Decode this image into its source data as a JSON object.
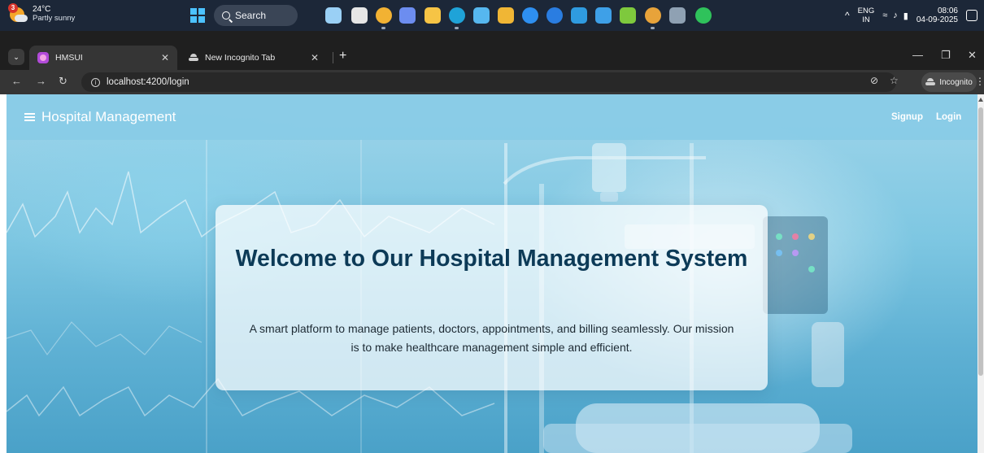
{
  "taskbar": {
    "weather": {
      "temp": "24°C",
      "condition": "Partly sunny",
      "badge": "3",
      "icon": "partly-sunny-icon"
    },
    "search_label": "Search",
    "apps": [
      {
        "name": "paint-app-icon",
        "color": "#9ad0f5"
      },
      {
        "name": "task-view-icon",
        "color": "#e6e6e6"
      },
      {
        "name": "chrome-icon",
        "color": "#f2b233"
      },
      {
        "name": "copilot-icon",
        "color": "#6c8df0"
      },
      {
        "name": "file-explorer-icon",
        "color": "#f6c445"
      },
      {
        "name": "edge-icon",
        "color": "#1fa3d8"
      },
      {
        "name": "terminal-app-icon",
        "color": "#56b7ef"
      },
      {
        "name": "store-icon",
        "color": "#f0b635"
      },
      {
        "name": "help-icon",
        "color": "#2e8ff0"
      },
      {
        "name": "hp-icon",
        "color": "#2a7de1"
      },
      {
        "name": "vscode-icon",
        "color": "#2f9be0"
      },
      {
        "name": "notepad-icon",
        "color": "#3ea0e8"
      },
      {
        "name": "spring-tool-icon",
        "color": "#7ec93d"
      },
      {
        "name": "chrome-v-icon",
        "color": "#e8a33a"
      },
      {
        "name": "cmd-icon",
        "color": "#8fa1b3"
      },
      {
        "name": "whatsapp-icon",
        "color": "#2fc25b"
      }
    ],
    "tray": {
      "lang_top": "ENG",
      "lang_bottom": "IN",
      "time": "08:06",
      "date": "04-09-2025"
    }
  },
  "browser": {
    "tabs": [
      {
        "label": "HMSUI",
        "active": true,
        "icon": "hmsui-favicon-icon"
      },
      {
        "label": "New Incognito Tab",
        "active": false,
        "icon": "incognito-icon"
      }
    ],
    "new_tab": "+",
    "url": "localhost:4200/login",
    "incognito_label": "Incognito"
  },
  "app": {
    "brand": "Hospital Management",
    "nav": {
      "signup": "Signup",
      "login": "Login"
    },
    "hero": {
      "title": "Welcome to Our Hospital Management System",
      "description": "A smart platform to manage patients, doctors, appointments, and billing seamlessly. Our mission is to make healthcare management simple and efficient."
    }
  },
  "colors": {
    "appbar": "#87cbe6",
    "title": "#0c3a57",
    "taskbar": "#1c2738"
  }
}
